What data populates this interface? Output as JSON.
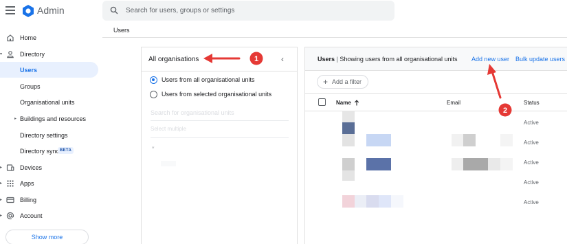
{
  "app": {
    "title": "Admin",
    "logo_color": "#1a73e8"
  },
  "search": {
    "placeholder": "Search for users, groups or settings"
  },
  "breadcrumb": {
    "current": "Users"
  },
  "sidebar": {
    "items": [
      {
        "label": "Home",
        "icon": "home-icon",
        "active": false
      },
      {
        "label": "Directory",
        "icon": "person-icon",
        "active": false,
        "expanded": true
      },
      {
        "label": "Users",
        "active": true
      },
      {
        "label": "Groups",
        "active": false
      },
      {
        "label": "Organisational units",
        "active": false
      },
      {
        "label": "Buildings and resources",
        "active": false,
        "expandable": true
      },
      {
        "label": "Directory settings",
        "active": false
      },
      {
        "label": "Directory sync",
        "badge": "BETA",
        "active": false
      },
      {
        "label": "Devices",
        "icon": "devices-icon",
        "active": false,
        "expandable": true
      },
      {
        "label": "Apps",
        "icon": "apps-grid-icon",
        "active": false,
        "expandable": true
      },
      {
        "label": "Billing",
        "icon": "credit-card-icon",
        "active": false,
        "expandable": true
      },
      {
        "label": "Account",
        "icon": "at-sign-icon",
        "active": false,
        "expandable": true
      }
    ],
    "show_more": "Show more"
  },
  "org_panel": {
    "title": "All organisations",
    "options": [
      {
        "label": "Users from all organisational units",
        "selected": true
      },
      {
        "label": "Users from selected organisational units",
        "selected": false
      }
    ],
    "search_placeholder": "Search for organisational units",
    "select_multiple": "Select multiple"
  },
  "users_panel": {
    "heading_bold": "Users",
    "heading_separator": "|",
    "heading_rest": "Showing users from all organisational units",
    "add_user": "Add new user",
    "bulk_update": "Bulk update users",
    "add_filter": "Add a filter",
    "columns": {
      "name": "Name",
      "email": "Email",
      "status": "Status"
    },
    "rows": [
      {
        "status": "Active"
      },
      {
        "status": "Active"
      },
      {
        "status": "Active"
      },
      {
        "status": "Active"
      },
      {
        "status": "Active"
      }
    ]
  },
  "annotations": [
    {
      "number": "1",
      "color": "#e53935"
    },
    {
      "number": "2",
      "color": "#e53935"
    }
  ],
  "colors": {
    "accent": "#1a73e8",
    "active_bg": "#e8f0fe",
    "annotation": "#e53935"
  }
}
